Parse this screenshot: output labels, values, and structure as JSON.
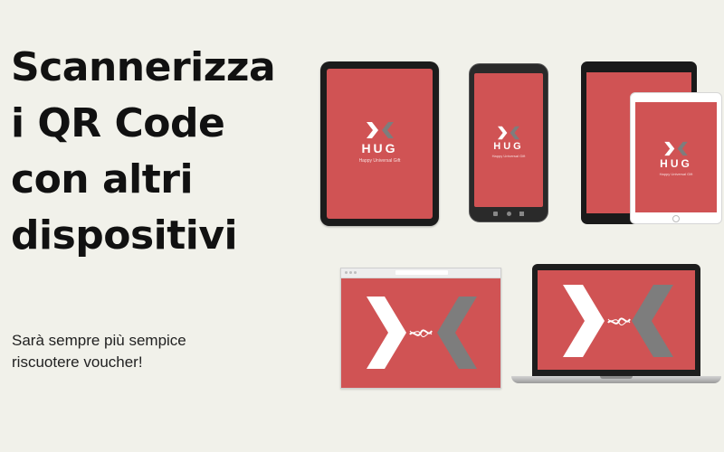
{
  "headline": [
    "Scannerizza",
    "i QR Code",
    "con altri",
    "dispositivi"
  ],
  "subtitle": [
    "Sarà sempre più sempice",
    "riscuotere voucher!"
  ],
  "brand": {
    "name": "HUG",
    "tagline": "Happy Universal Gift"
  },
  "colors": {
    "background": "#f1f1ea",
    "brand_red": "#d05354",
    "arrow_white": "#ffffff",
    "arrow_grey": "#7d7d7d"
  }
}
